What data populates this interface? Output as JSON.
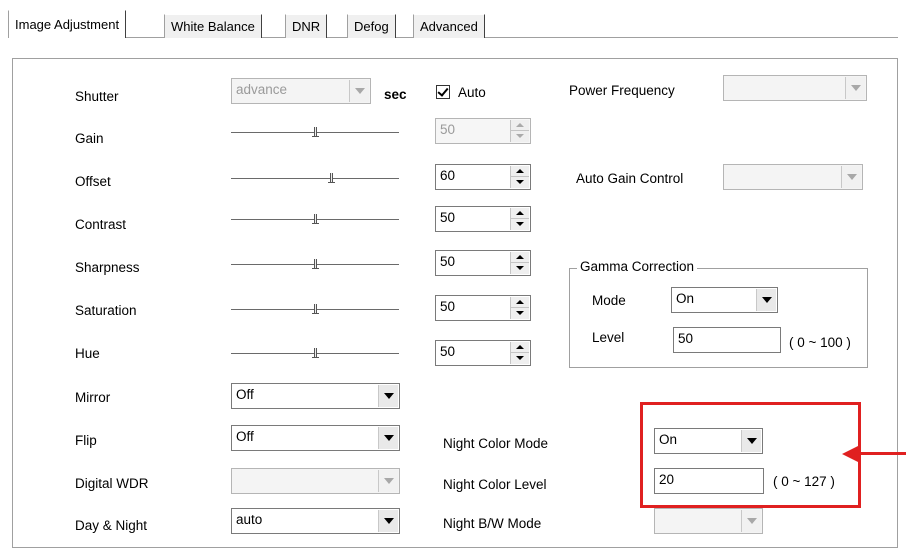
{
  "tabs": [
    {
      "label": "Image Adjustment",
      "active": true
    },
    {
      "label": "White Balance",
      "active": false
    },
    {
      "label": "DNR",
      "active": false
    },
    {
      "label": "Defog",
      "active": false
    },
    {
      "label": "Advanced",
      "active": false
    }
  ],
  "fields": {
    "shutter": {
      "label": "Shutter",
      "value": "advance",
      "unit": "sec"
    },
    "auto": {
      "label": "Auto",
      "checked": true
    },
    "power_frequency": {
      "label": "Power Frequency",
      "value": ""
    },
    "gain": {
      "label": "Gain",
      "value": "50",
      "slider": 0.5
    },
    "offset": {
      "label": "Offset",
      "value": "60",
      "slider": 0.6
    },
    "auto_gain_control": {
      "label": "Auto Gain Control",
      "value": ""
    },
    "contrast": {
      "label": "Contrast",
      "value": "50",
      "slider": 0.5
    },
    "sharpness": {
      "label": "Sharpness",
      "value": "50",
      "slider": 0.5
    },
    "saturation": {
      "label": "Saturation",
      "value": "50",
      "slider": 0.5
    },
    "hue": {
      "label": "Hue",
      "value": "50",
      "slider": 0.5
    },
    "mirror": {
      "label": "Mirror",
      "value": "Off"
    },
    "flip": {
      "label": "Flip",
      "value": "Off"
    },
    "digital_wdr": {
      "label": "Digital WDR",
      "value": ""
    },
    "day_night": {
      "label": "Day & Night",
      "value": "auto"
    }
  },
  "gamma": {
    "title": "Gamma Correction",
    "mode_label": "Mode",
    "mode_value": "On",
    "level_label": "Level",
    "level_value": "50",
    "range": "( 0 ~ 100 )"
  },
  "night": {
    "color_mode_label": "Night Color Mode",
    "color_mode_value": "On",
    "color_level_label": "Night Color Level",
    "color_level_value": "20",
    "color_level_range": "( 0 ~ 127 )",
    "bw_mode_label": "Night B/W Mode",
    "bw_mode_value": ""
  },
  "colors": {
    "highlight": "#e02020"
  }
}
